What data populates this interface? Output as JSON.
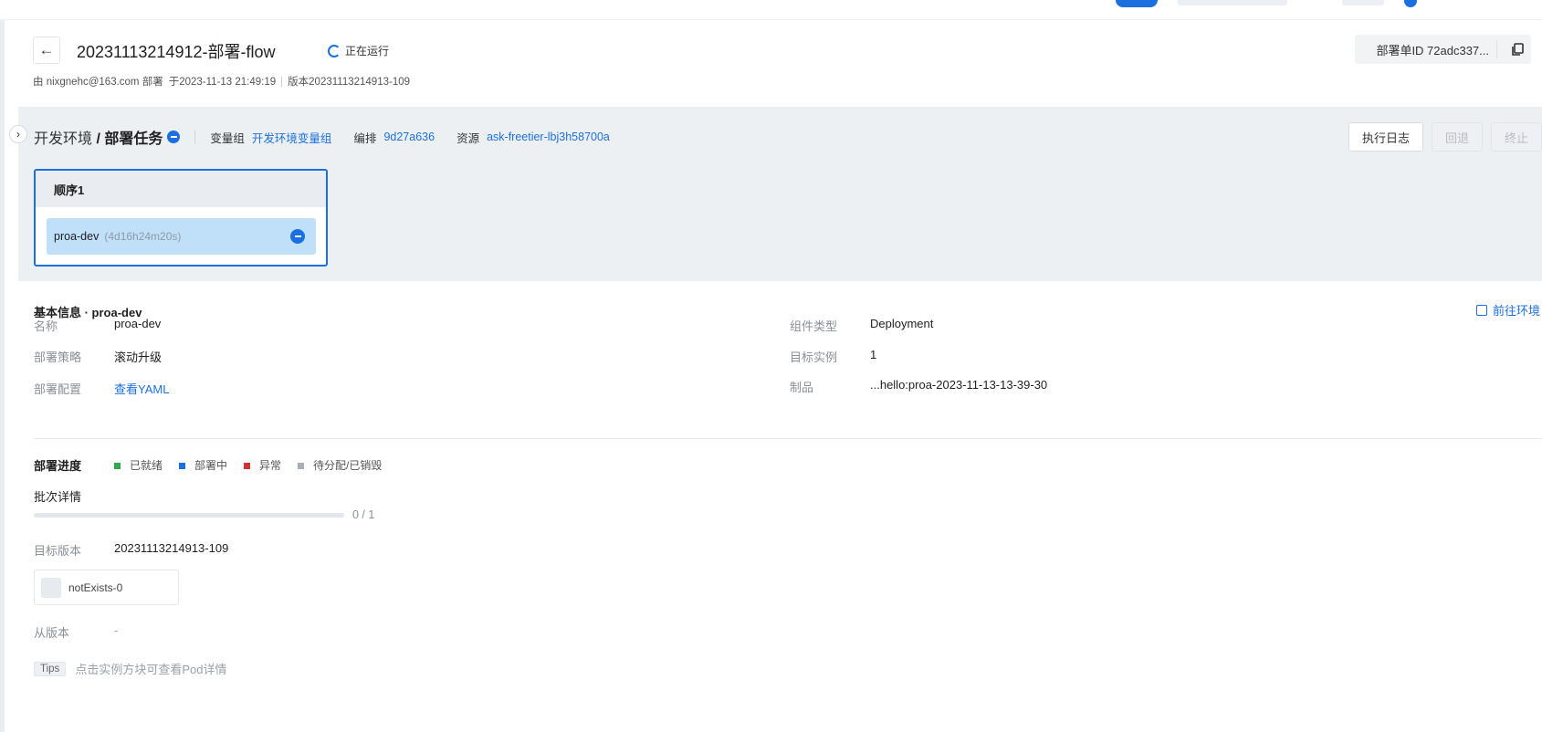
{
  "header": {
    "back_icon": "arrow-left-icon",
    "title": "20231113214912-部署-flow",
    "status_text": "正在运行",
    "deployer": "由 nixgnehc@163.com 部署",
    "deployed_at": "于2023-11-13 21:49:19",
    "version": "版本20231113214913-109",
    "deploy_id": "部署单ID 72adc337...",
    "copy_icon": "copy-icon"
  },
  "stage": {
    "env": "开发环境",
    "separator": "/",
    "task": "部署任务",
    "vargroup_label": "变量组",
    "vargroup_value": "开发环境变量组",
    "orchestration_label": "编排",
    "orchestration_value": "9d27a636",
    "resource_label": "资源",
    "resource_value": "ask-freetier-lbj3h58700a",
    "actions": {
      "log": "执行日志",
      "rollback": "回退",
      "stop": "终止"
    },
    "order": {
      "title": "顺序1",
      "item_name": "proa-dev",
      "item_duration": "(4d16h24m20s)"
    }
  },
  "info": {
    "title": "基本信息 · proa-dev",
    "goto": "前往环境",
    "name_label": "名称",
    "name_value": "proa-dev",
    "strategy_label": "部署策略",
    "strategy_value": "滚动升级",
    "config_label": "部署配置",
    "config_value": "查看YAML",
    "component_label": "组件类型",
    "component_value": "Deployment",
    "target_label": "目标实例",
    "target_value": "1",
    "artifact_label": "制品",
    "artifact_value": "...hello:proa-2023-11-13-13-39-30",
    "progress_label": "部署进度",
    "legend": [
      {
        "label": "已就绪",
        "color": "#2fa84f"
      },
      {
        "label": "部署中",
        "color": "#1b6fde"
      },
      {
        "label": "异常",
        "color": "#d0332b"
      },
      {
        "label": "待分配/已销毁",
        "color": "#a8aeb6"
      }
    ],
    "batch_label": "批次详情",
    "progress_fraction": 0,
    "progress_text": "0 / 1",
    "target_version_label": "目标版本",
    "target_version_value": "20231113214913-109",
    "instance_name": "notExists-0",
    "from_version_label": "从版本",
    "from_version_value": "-",
    "tips_tag": "Tips",
    "tips_text": "点击实例方块可查看Pod详情"
  }
}
